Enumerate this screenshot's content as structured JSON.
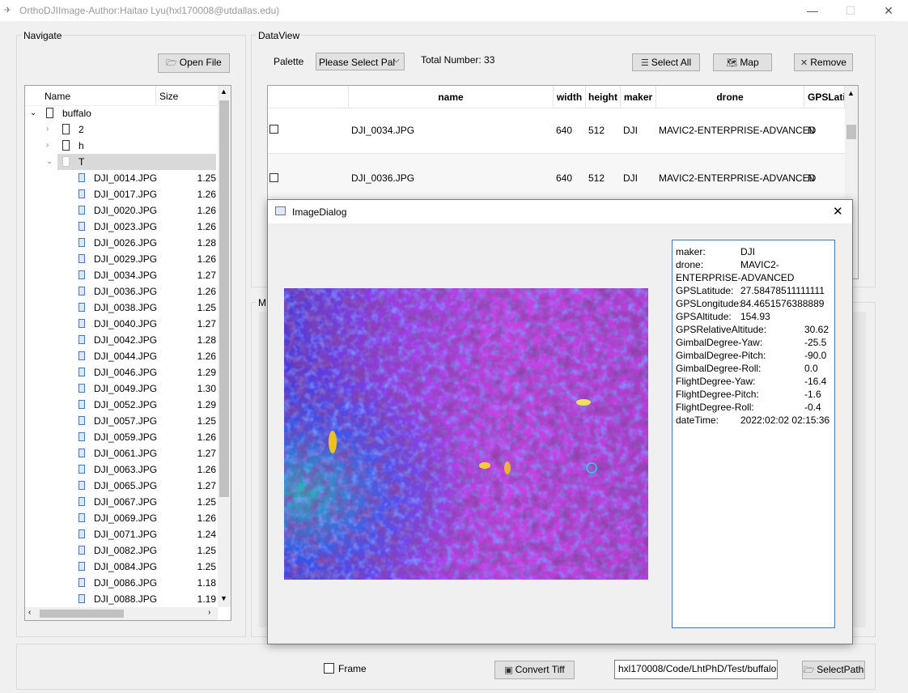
{
  "window": {
    "title": "OrthoDJIImage-Author:Haitao Lyu(hxl170008@utdallas.edu)",
    "minimize": "—",
    "maximize": "☐",
    "close": "✕"
  },
  "navigate": {
    "label": "Navigate",
    "open_file": "Open File",
    "col_name": "Name",
    "col_size": "Size",
    "root": "buffalo",
    "folders": [
      "2",
      "h",
      "T"
    ],
    "files": [
      {
        "name": "DJI_0014.JPG",
        "size": "1.25"
      },
      {
        "name": "DJI_0017.JPG",
        "size": "1.26"
      },
      {
        "name": "DJI_0020.JPG",
        "size": "1.26"
      },
      {
        "name": "DJI_0023.JPG",
        "size": "1.26"
      },
      {
        "name": "DJI_0026.JPG",
        "size": "1.28"
      },
      {
        "name": "DJI_0029.JPG",
        "size": "1.26"
      },
      {
        "name": "DJI_0034.JPG",
        "size": "1.27"
      },
      {
        "name": "DJI_0036.JPG",
        "size": "1.26"
      },
      {
        "name": "DJI_0038.JPG",
        "size": "1.25"
      },
      {
        "name": "DJI_0040.JPG",
        "size": "1.27"
      },
      {
        "name": "DJI_0042.JPG",
        "size": "1.28"
      },
      {
        "name": "DJI_0044.JPG",
        "size": "1.26"
      },
      {
        "name": "DJI_0046.JPG",
        "size": "1.29"
      },
      {
        "name": "DJI_0049.JPG",
        "size": "1.30"
      },
      {
        "name": "DJI_0052.JPG",
        "size": "1.29"
      },
      {
        "name": "DJI_0057.JPG",
        "size": "1.25"
      },
      {
        "name": "DJI_0059.JPG",
        "size": "1.26"
      },
      {
        "name": "DJI_0061.JPG",
        "size": "1.27"
      },
      {
        "name": "DJI_0063.JPG",
        "size": "1.26"
      },
      {
        "name": "DJI_0065.JPG",
        "size": "1.27"
      },
      {
        "name": "DJI_0067.JPG",
        "size": "1.25"
      },
      {
        "name": "DJI_0069.JPG",
        "size": "1.26"
      },
      {
        "name": "DJI_0071.JPG",
        "size": "1.24"
      },
      {
        "name": "DJI_0082.JPG",
        "size": "1.25"
      },
      {
        "name": "DJI_0084.JPG",
        "size": "1.25"
      },
      {
        "name": "DJI_0086.JPG",
        "size": "1.18"
      },
      {
        "name": "DJI_0088.JPG",
        "size": "1.19"
      }
    ]
  },
  "dataview": {
    "label": "DataView",
    "palette_label": "Palette",
    "palette_value": "Please Select Pal",
    "total": "Total Number: 33",
    "select_all": "Select All",
    "map": "Map",
    "remove": "Remove",
    "columns": [
      "name",
      "width",
      "height",
      "maker",
      "drone",
      "GPSLati"
    ],
    "rows": [
      {
        "name": "DJI_0034.JPG",
        "width": "640",
        "height": "512",
        "maker": "DJI",
        "drone": "MAVIC2-ENTERPRISE-ADVANCED",
        "gps": "N"
      },
      {
        "name": "DJI_0036.JPG",
        "width": "640",
        "height": "512",
        "maker": "DJI",
        "drone": "MAVIC2-ENTERPRISE-ADVANCED",
        "gps": "N"
      }
    ]
  },
  "map_group_label_partial": "M",
  "dialog": {
    "title": "ImageDialog",
    "close": "✕",
    "info": [
      {
        "key": "maker:",
        "value": "DJI"
      },
      {
        "key": "drone:",
        "value": "MAVIC2-"
      },
      {
        "key": "ENTERPRISE-ADVANCED",
        "value": ""
      },
      {
        "key": "GPSLatitude:",
        "value": "27.58478511111111"
      },
      {
        "key": "GPSLongitude:",
        "value": "84.4651576388889"
      },
      {
        "key": "GPSAltitude:",
        "value": "154.93"
      },
      {
        "key": "GPSRelativeAltitude:",
        "value": "30.62"
      },
      {
        "key": "GimbalDegree-Yaw:",
        "value": "-25.5"
      },
      {
        "key": "GimbalDegree-Pitch:",
        "value": "-90.0"
      },
      {
        "key": "GimbalDegree-Roll:",
        "value": "0.0"
      },
      {
        "key": "FlightDegree-Yaw:",
        "value": "-16.4"
      },
      {
        "key": "FlightDegree-Pitch:",
        "value": "-1.6"
      },
      {
        "key": "FlightDegree-Roll:",
        "value": "-0.4"
      },
      {
        "key": "dateTime:",
        "value": "2022:02:02 02:15:36"
      }
    ]
  },
  "bottom": {
    "frame": "Frame",
    "convert": "Convert Tiff",
    "path": "hxl170008/Code/LhtPhD/Test/buffalo",
    "select_path": "SelectPath"
  },
  "colors": {
    "accent": "#3c78b4",
    "thermal_base": "#c040e0",
    "thermal_cool": "#3050ff"
  }
}
